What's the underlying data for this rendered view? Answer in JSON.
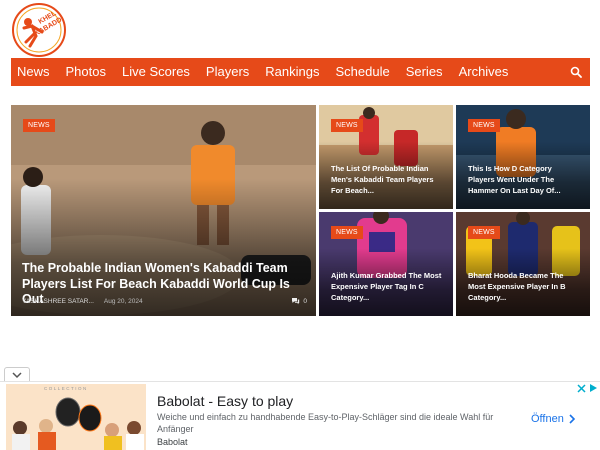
{
  "brand": {
    "logo_line1": "KHEL",
    "logo_line2": "KABADDI",
    "accent": "#e64a19"
  },
  "nav": {
    "items": [
      "News",
      "Photos",
      "Live Scores",
      "Players",
      "Rankings",
      "Schedule",
      "Series",
      "Archives"
    ],
    "search_icon": "search-icon"
  },
  "featured": {
    "main": {
      "badge": "NEWS",
      "title": "The Probable Indian Women's Kabaddi Team Players List For Beach Kabaddi World Cup Is Out",
      "author": "YASHASHREE SATAR...",
      "date": "Aug 20, 2024",
      "comments": "0"
    },
    "tiles": [
      {
        "badge": "NEWS",
        "title": "The List Of Probable Indian Men's Kabaddi Team Players For Beach..."
      },
      {
        "badge": "NEWS",
        "title": "This Is How D Category Players Went Under The Hammer On Last Day Of..."
      },
      {
        "badge": "NEWS",
        "title": "Ajith Kumar Grabbed The Most Expensive Player Tag In C Category..."
      },
      {
        "badge": "NEWS",
        "title": "Bharat Hooda Became The Most Expensive Player In B Category..."
      }
    ]
  },
  "ad": {
    "title": "Babolat - Easy to play",
    "description": "Weiche und einfach zu handhabende Easy-to-Play-Schläger sind die ideale Wahl für Anfänger",
    "advertiser": "Babolat",
    "cta": "Öffnen",
    "image_caption": "COLLECTION"
  }
}
